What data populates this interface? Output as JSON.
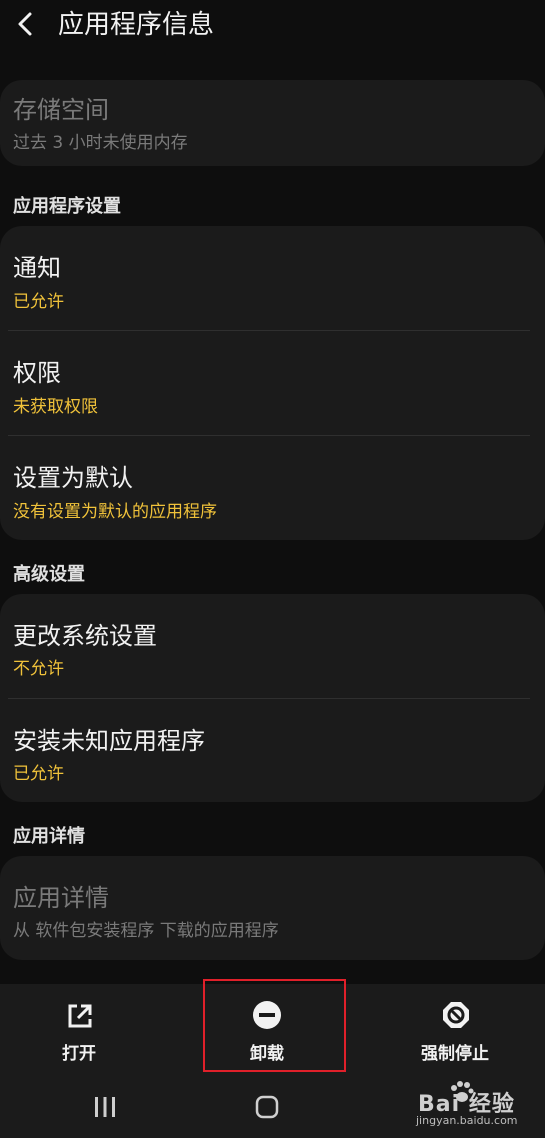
{
  "header": {
    "title": "应用程序信息"
  },
  "storage": {
    "title": "存储空间",
    "subtitle": "过去 3 小时未使用内存"
  },
  "app_settings": {
    "header": "应用程序设置",
    "items": [
      {
        "title": "通知",
        "subtitle": "已允许"
      },
      {
        "title": "权限",
        "subtitle": "未获取权限"
      },
      {
        "title": "设置为默认",
        "subtitle": "没有设置为默认的应用程序"
      }
    ]
  },
  "advanced": {
    "header": "高级设置",
    "items": [
      {
        "title": "更改系统设置",
        "subtitle": "不允许"
      },
      {
        "title": "安装未知应用程序",
        "subtitle": "已允许"
      }
    ]
  },
  "details": {
    "header": "应用详情",
    "title": "应用详情",
    "subtitle": "从 软件包安装程序 下载的应用程序"
  },
  "actions": {
    "open": "打开",
    "uninstall": "卸载",
    "force_stop": "强制停止"
  },
  "watermark": {
    "text": "Bai 经验",
    "sub": "jingyan.baidu.com"
  },
  "colors": {
    "accent_yellow": "#f0c23a",
    "highlight_red": "#e0202a",
    "card_bg": "#1b1b1b"
  }
}
